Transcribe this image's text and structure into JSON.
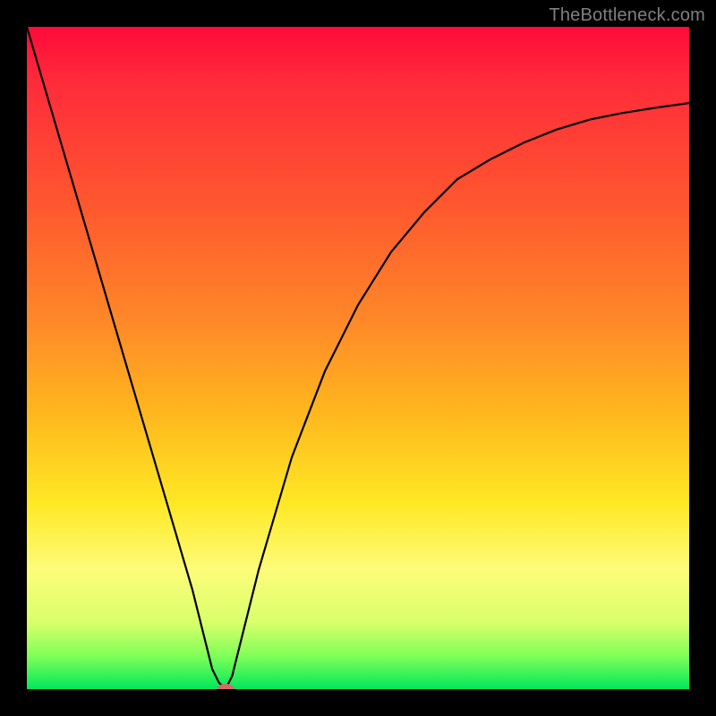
{
  "watermark": "TheBottleneck.com",
  "chart_data": {
    "type": "line",
    "title": "",
    "xlabel": "",
    "ylabel": "",
    "xlim": [
      0,
      1
    ],
    "ylim": [
      0,
      1
    ],
    "series": [
      {
        "name": "bottleneck-curve",
        "x": [
          0.0,
          0.05,
          0.1,
          0.15,
          0.2,
          0.25,
          0.28,
          0.29,
          0.3,
          0.31,
          0.32,
          0.35,
          0.4,
          0.45,
          0.5,
          0.55,
          0.6,
          0.65,
          0.7,
          0.75,
          0.8,
          0.85,
          0.9,
          0.95,
          1.0
        ],
        "y": [
          1.0,
          0.83,
          0.66,
          0.49,
          0.32,
          0.15,
          0.03,
          0.01,
          0.0,
          0.02,
          0.06,
          0.18,
          0.35,
          0.48,
          0.58,
          0.66,
          0.72,
          0.77,
          0.8,
          0.825,
          0.845,
          0.86,
          0.87,
          0.878,
          0.885
        ]
      }
    ],
    "annotations": [
      {
        "name": "dip-marker",
        "x": 0.3,
        "y": 0.0,
        "shape": "ellipse",
        "color": "#d66a68"
      }
    ],
    "background_gradient": [
      "#ff0a3a",
      "#ff8a28",
      "#ffe824",
      "#00e85a"
    ],
    "notes": "V-shaped curve: steep linear descent from top-left to x≈0.30, sharp dip to y=0, then concave recovery asymptoting toward y≈0.88 at right edge."
  }
}
